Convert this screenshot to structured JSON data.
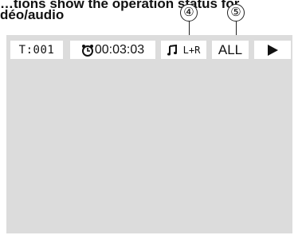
{
  "heading": {
    "line1": "…tions show the operation status for",
    "line2": "déo/audio"
  },
  "callouts": [
    {
      "label": "④"
    },
    {
      "label": "⑤"
    }
  ],
  "osd": {
    "title_text": "T:001",
    "clock_icon": "clock-icon",
    "time_text": "00:03:03",
    "audio_icon": "music-note-icon",
    "audio_text": "L+R",
    "repeat_text": "ALL",
    "play_icon": "play-icon"
  },
  "colors": {
    "screen_background": "#dcdcdc",
    "box_background": "#ffffff",
    "text": "#111111"
  }
}
